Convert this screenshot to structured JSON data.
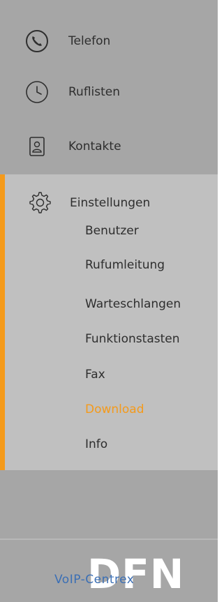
{
  "nav": {
    "phone": {
      "label": "Telefon",
      "icon": "phone-icon"
    },
    "calls": {
      "label": "Ruflisten",
      "icon": "clock-icon"
    },
    "contacts": {
      "label": "Kontakte",
      "icon": "contact-card-icon"
    }
  },
  "settings": {
    "label": "Einstellungen",
    "icon": "gear-icon",
    "items": [
      {
        "label": "Benutzer"
      },
      {
        "label": "Rufumleitung"
      },
      {
        "label": "Warteschlangen"
      },
      {
        "label": "Funktionstasten"
      },
      {
        "label": "Fax"
      },
      {
        "label": "Download",
        "active": true
      },
      {
        "label": "Info"
      }
    ]
  },
  "logo": {
    "brand": "DFN",
    "product": "VoIP-Centrex"
  },
  "colors": {
    "sidebar": "#a6a6a6",
    "settings_background": "#c0c0c0",
    "accent": "#f49a1b",
    "text": "#2e2e2e",
    "logo_text": "#3b6fb5"
  }
}
